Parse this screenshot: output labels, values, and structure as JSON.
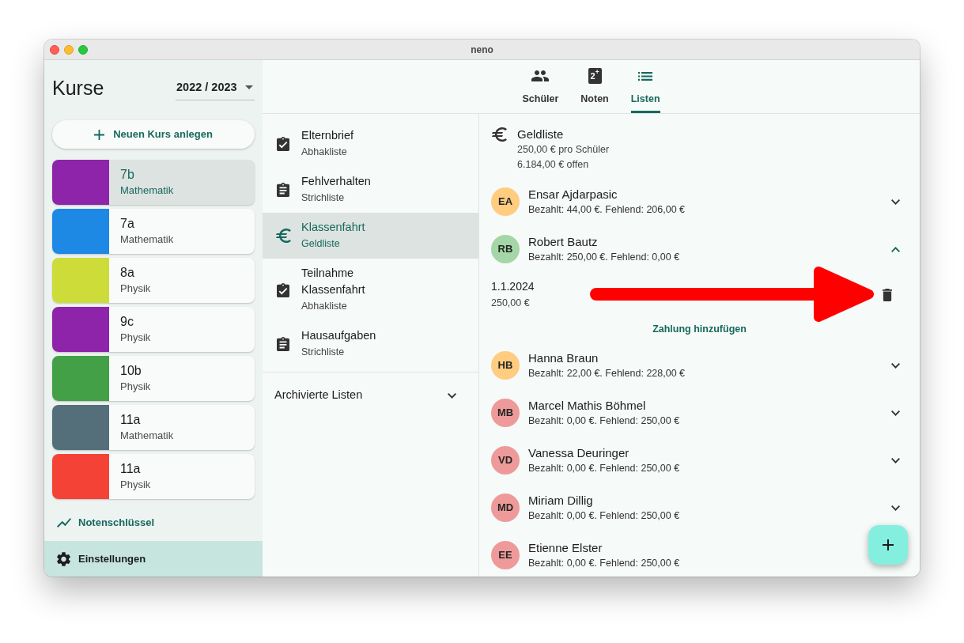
{
  "window": {
    "title": "neno"
  },
  "sidebar": {
    "title": "Kurse",
    "year": "2022 / 2023",
    "new_course": "Neuen Kurs anlegen",
    "courses": [
      {
        "name": "7b",
        "subject": "Mathematik",
        "color": "#8e24aa",
        "selected": true
      },
      {
        "name": "7a",
        "subject": "Mathematik",
        "color": "#1e88e5",
        "selected": false
      },
      {
        "name": "8a",
        "subject": "Physik",
        "color": "#cddc39",
        "selected": false
      },
      {
        "name": "9c",
        "subject": "Physik",
        "color": "#8e24aa",
        "selected": false
      },
      {
        "name": "10b",
        "subject": "Physik",
        "color": "#43a047",
        "selected": false
      },
      {
        "name": "11a",
        "subject": "Mathematik",
        "color": "#546e7a",
        "selected": false
      },
      {
        "name": "11a",
        "subject": "Physik",
        "color": "#f44336",
        "selected": false
      }
    ],
    "grading_key": "Notenschlüssel",
    "settings": "Einstellungen"
  },
  "tabs": [
    {
      "label": "Schüler",
      "kind": "students",
      "selected": false
    },
    {
      "label": "Noten",
      "kind": "grades",
      "icon_text": "2$^{+}$",
      "selected": false
    },
    {
      "label": "Listen",
      "kind": "lists",
      "selected": true
    }
  ],
  "lists": {
    "items": [
      {
        "title": "Elternbrief",
        "type": "Abhakliste",
        "kind": "check",
        "selected": false
      },
      {
        "title": "Fehlverhalten",
        "type": "Strichliste",
        "kind": "tally",
        "selected": false
      },
      {
        "title": "Klassenfahrt",
        "type": "Geldliste",
        "kind": "money",
        "selected": true
      },
      {
        "title": "Teilnahme Klassenfahrt",
        "type": "Abhakliste",
        "kind": "check",
        "selected": false
      },
      {
        "title": "Hausaufgaben",
        "type": "Strichliste",
        "kind": "tally",
        "selected": false
      }
    ],
    "archived": {
      "label": "Archivierte Listen",
      "expanded": false
    }
  },
  "detail": {
    "title": "Geldliste",
    "per_student": "250,00 € pro Schüler",
    "open_total": "6.184,00 € offen",
    "students": [
      {
        "initials": "EA",
        "name": "Ensar Ajdarpasic",
        "summary": "Bezahlt: 44,00 €. Fehlend: 206,00 €",
        "color": "#ffcc80",
        "expanded": false
      },
      {
        "initials": "RB",
        "name": "Robert Bautz",
        "summary": "Bezahlt: 250,00 €. Fehlend: 0,00 €",
        "color": "#a5d6a7",
        "expanded": true,
        "payments": [
          {
            "date": "1.1.2024",
            "amount": "250,00 €"
          }
        ],
        "add_payment": "Zahlung hinzufügen"
      },
      {
        "initials": "HB",
        "name": "Hanna Braun",
        "summary": "Bezahlt: 22,00 €. Fehlend: 228,00 €",
        "color": "#ffcc80",
        "expanded": false
      },
      {
        "initials": "MB",
        "name": "Marcel Mathis Böhmel",
        "summary": "Bezahlt: 0,00 €. Fehlend: 250,00 €",
        "color": "#ef9a9a",
        "expanded": false
      },
      {
        "initials": "VD",
        "name": "Vanessa Deuringer",
        "summary": "Bezahlt: 0,00 €. Fehlend: 250,00 €",
        "color": "#ef9a9a",
        "expanded": false
      },
      {
        "initials": "MD",
        "name": "Miriam Dillig",
        "summary": "Bezahlt: 0,00 €. Fehlend: 250,00 €",
        "color": "#ef9a9a",
        "expanded": false
      },
      {
        "initials": "EE",
        "name": "Etienne Elster",
        "summary": "Bezahlt: 0,00 €. Fehlend: 250,00 €",
        "color": "#ef9a9a"
      }
    ]
  }
}
